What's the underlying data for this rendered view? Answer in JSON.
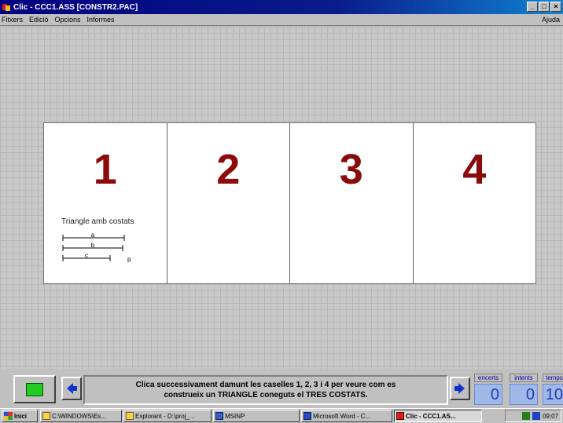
{
  "window": {
    "title": "Clic - CCC1.ASS [CONSTR2.PAC]"
  },
  "menu": {
    "items": [
      "Fitxers",
      "Edició",
      "Opcions",
      "Informes"
    ],
    "help": "Ajuda"
  },
  "board": {
    "cells": [
      {
        "number": "1",
        "text": "Triangle amb costats",
        "segments": [
          "a",
          "b",
          "c"
        ],
        "side_label": "p"
      },
      {
        "number": "2"
      },
      {
        "number": "3"
      },
      {
        "number": "4"
      }
    ]
  },
  "message": {
    "line1": "Clica successivament damunt les caselles 1, 2, 3 i 4 per veure com es",
    "line2": "construeix un TRIANGLE coneguts el TRES COSTATS."
  },
  "counters": [
    {
      "label": "encerts",
      "value": "0"
    },
    {
      "label": "intents",
      "value": "0"
    },
    {
      "label": "temps",
      "value": "10"
    }
  ],
  "taskbar": {
    "start": "Inici",
    "tasks": [
      "C:\\WINDOWS\\Es...",
      "Explorant - D:\\proj_...",
      "MSINP",
      "Microsoft Word - C...",
      "Clic - CCC1.AS..."
    ],
    "clock": "09:07"
  },
  "colors": {
    "number": "#8b0a0a",
    "titlebar": "#000080",
    "counter_bg": "#a0b8e8"
  }
}
